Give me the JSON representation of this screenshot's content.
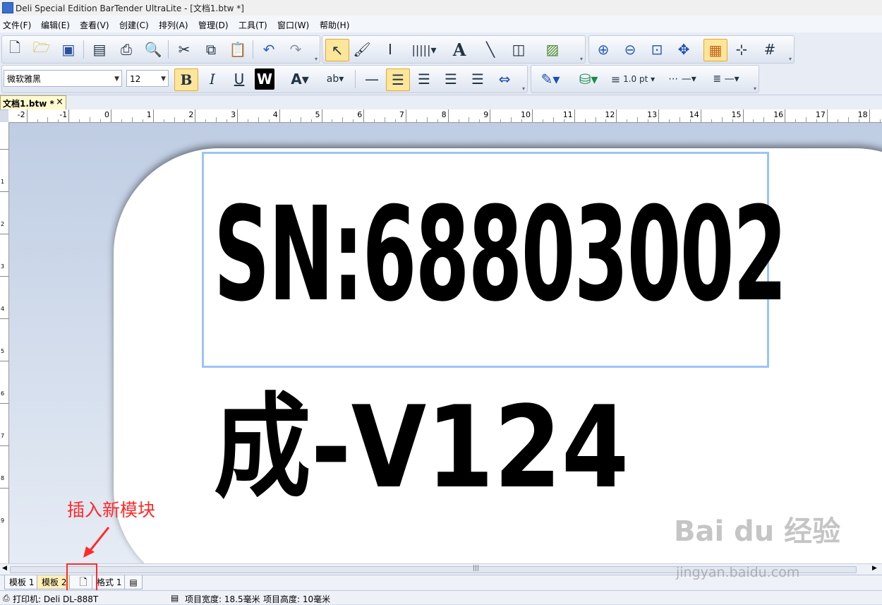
{
  "window": {
    "title": "Deli Special Edition BarTender UltraLite - [文档1.btw *]"
  },
  "menu": [
    "文件(F)",
    "编辑(E)",
    "查看(V)",
    "创建(C)",
    "排列(A)",
    "管理(D)",
    "工具(T)",
    "窗口(W)",
    "帮助(H)"
  ],
  "format_toolbar": {
    "font": "微软雅黑",
    "size": "12",
    "line_width": "1.0 pt"
  },
  "document_tab": {
    "label": "文档1.btw *",
    "close": "×"
  },
  "ruler": {
    "h_ticks": [
      "-2",
      "-1",
      "0",
      "1",
      "2",
      "3",
      "4",
      "5",
      "6",
      "7",
      "8",
      "9",
      "10",
      "11",
      "12",
      "13",
      "14",
      "15",
      "16",
      "17",
      "18"
    ],
    "v_ticks": [
      "1",
      "2",
      "3",
      "4",
      "5",
      "6",
      "7",
      "8",
      "9"
    ]
  },
  "label": {
    "line1": "SN:68803002",
    "line2": "成-V124"
  },
  "annotation": {
    "text": "插入新模块",
    "color": "#ff2a2a"
  },
  "sheet_tabs": [
    "模板 1",
    "模板 2",
    "格式 1"
  ],
  "status": {
    "printer": "打印机: Deli DL-888T",
    "item_width": "项目宽度: 18.5毫米",
    "item_height": "项目高度: 10毫米"
  },
  "watermark": {
    "brand": "Bai du 经验",
    "url": "jingyan.baidu.com"
  },
  "colors": {
    "selection": "#9cc4f2",
    "active_tab": "#fff0b8",
    "annotation": "#ff2a2a"
  }
}
